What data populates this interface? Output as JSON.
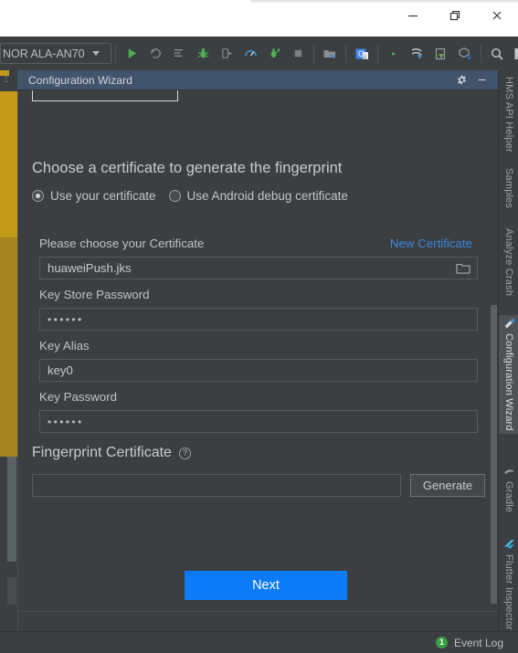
{
  "os_window": {
    "controls": [
      {
        "name": "minimize",
        "glyph": "minimize-icon"
      },
      {
        "name": "restore",
        "glyph": "restore-icon"
      },
      {
        "name": "close",
        "glyph": "close-icon"
      }
    ]
  },
  "ide_toolbar": {
    "device_selector": {
      "label": "NOR ALA-AN70",
      "caret": "chevron-down-icon"
    },
    "buttons": [
      {
        "name": "run-icon",
        "title": "Run"
      },
      {
        "name": "rerun-icon",
        "title": "Apply Changes"
      },
      {
        "name": "apply-code-changes-icon",
        "title": "Apply Code Changes"
      },
      {
        "name": "debug-icon",
        "title": "Debug"
      },
      {
        "name": "attach-debugger-icon",
        "title": "Attach Debugger"
      },
      {
        "name": "profiler-icon",
        "title": "Profile"
      },
      {
        "name": "run-coverage-icon",
        "title": "Run with Coverage"
      },
      {
        "name": "stop-icon",
        "title": "Stop"
      },
      {
        "name": "sdk-manager-icon",
        "title": "SDK Manager"
      },
      {
        "name": "translate-icon",
        "title": "Translate"
      },
      {
        "name": "avd-manager-icon",
        "title": "AVD Manager"
      },
      {
        "name": "device-file-explorer-icon",
        "title": "Device File Explorer"
      },
      {
        "name": "layout-inspector-icon",
        "title": "Layout Inspector"
      },
      {
        "name": "build-apk-icon",
        "title": "Build APK"
      },
      {
        "name": "search-icon",
        "title": "Search Everywhere"
      },
      {
        "name": "account-icon",
        "title": "Account"
      }
    ]
  },
  "tool_window": {
    "title": "Configuration Wizard",
    "actions": [
      {
        "name": "settings-gear-icon",
        "title": "Settings"
      },
      {
        "name": "hide-icon",
        "title": "Hide"
      }
    ]
  },
  "wizard": {
    "section_title": "Choose a certificate to generate the fingerprint",
    "certificate_options": [
      {
        "label": "Use your certificate",
        "selected": true
      },
      {
        "label": "Use Android debug certificate",
        "selected": false
      }
    ],
    "fields": [
      {
        "label": "Please choose your Certificate",
        "value": "huaweiPush.jks",
        "placeholder": "",
        "link": "New Certificate",
        "trailing_icon": "folder-icon",
        "masked": false
      },
      {
        "label": "Key Store Password",
        "value": "••••••",
        "placeholder": "",
        "link": "",
        "trailing_icon": "",
        "masked": true
      },
      {
        "label": "Key Alias",
        "value": "key0",
        "placeholder": "",
        "link": "",
        "trailing_icon": "",
        "masked": false
      },
      {
        "label": "Key Password",
        "value": "••••••",
        "placeholder": "",
        "link": "",
        "trailing_icon": "",
        "masked": true
      }
    ],
    "fingerprint": {
      "title": "Fingerprint Certificate",
      "help_icon": "help-question-icon",
      "value": "",
      "placeholder": "",
      "generate_label": "Generate"
    },
    "next_label": "Next",
    "accent_color": "#0d7bf7",
    "link_color": "#3a86e0"
  },
  "right_tabs": [
    {
      "label": "HMS API Helper",
      "active": false,
      "icon": ""
    },
    {
      "label": "Samples",
      "active": false,
      "icon": ""
    },
    {
      "label": "Analyze Crash",
      "active": false,
      "icon": ""
    },
    {
      "label": "Configuration Wizard",
      "active": true,
      "icon": "wizard-icon"
    },
    {
      "label": "Gradle",
      "active": false,
      "icon": "gradle-icon"
    },
    {
      "label": "Flutter Inspector",
      "active": false,
      "icon": "flutter-icon"
    }
  ],
  "status_bar": {
    "event_log_label": "Event Log",
    "event_log_count": "1",
    "event_badge_color": "#389c44"
  },
  "editor_remnant": {
    "line_number": "1"
  }
}
